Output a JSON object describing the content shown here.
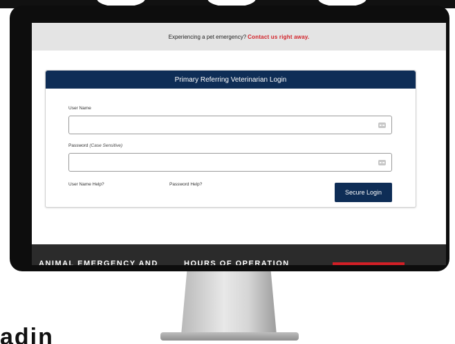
{
  "banner": {
    "text": "Experiencing a pet emergency?",
    "link": "Contact us right away."
  },
  "login": {
    "title": "Primary Referring Veterinarian Login",
    "username_label": "User Name",
    "password_label": "Password",
    "password_note": "(Case Sensitive)",
    "username_help": "User Name Help?",
    "password_help": "Password Help?",
    "submit": "Secure Login"
  },
  "footer": {
    "text1": "ANIMAL EMERGENCY AND",
    "text2": "HOURS OF OPERATION"
  },
  "bottom_text": "adin",
  "colors": {
    "navy": "#0e2d56",
    "accent_red": "#d21f26",
    "banner_gray": "#e4e4e4"
  }
}
